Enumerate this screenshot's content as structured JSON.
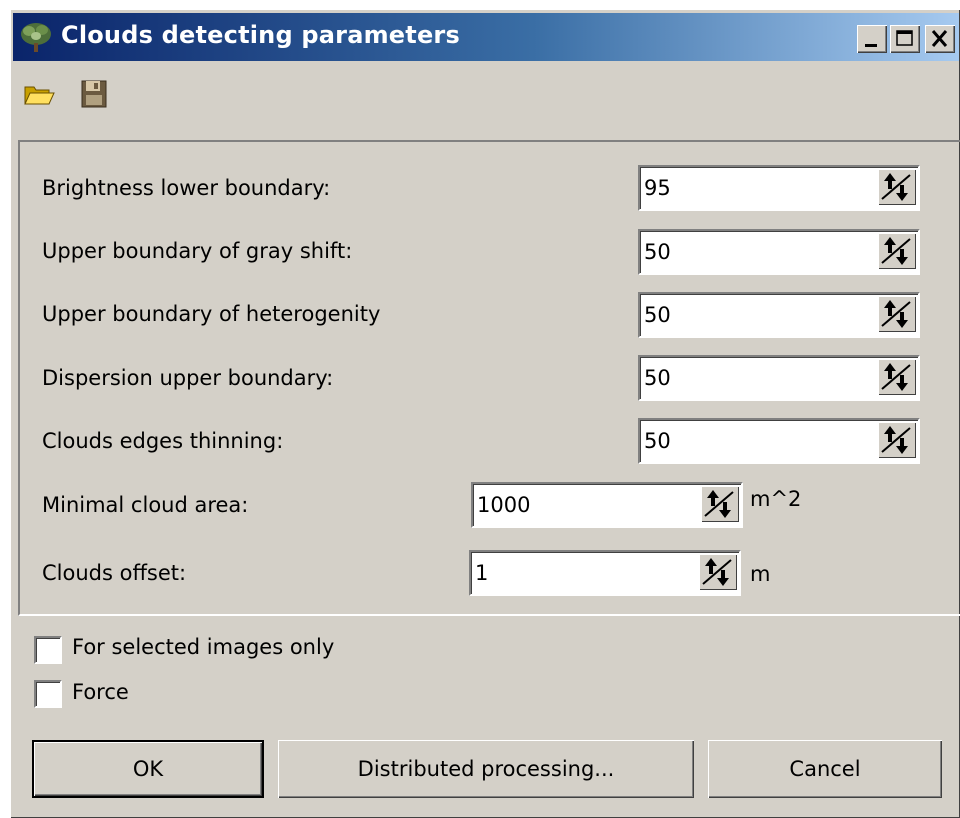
{
  "window": {
    "title": "Clouds detecting parameters",
    "app_icon": "tree-icon",
    "controls": [
      "minimize-icon",
      "maximize-icon",
      "close-icon"
    ]
  },
  "toolbar": {
    "items": [
      {
        "name": "open-folder-icon"
      },
      {
        "name": "save-disk-icon"
      }
    ]
  },
  "params": {
    "brightness_label": "Brightness lower boundary:",
    "brightness_value": "95",
    "gray_shift_label": "Upper boundary of gray shift:",
    "gray_shift_value": "50",
    "heterogenity_label": "Upper boundary of heterogenity",
    "heterogenity_value": "50",
    "dispersion_label": "Dispersion upper boundary:",
    "dispersion_value": "50",
    "edges_label": "Clouds edges thinning:",
    "edges_value": "50",
    "min_area_label": "Minimal cloud area:",
    "min_area_value": "1000",
    "min_area_unit": "m^2",
    "offset_label": "Clouds offset:",
    "offset_value": "1",
    "offset_unit": "m"
  },
  "options": {
    "selected_only_label": "For selected images only",
    "selected_only_checked": false,
    "force_label": "Force",
    "force_checked": false
  },
  "buttons": {
    "ok": "OK",
    "distributed": "Distributed processing...",
    "cancel": "Cancel"
  }
}
